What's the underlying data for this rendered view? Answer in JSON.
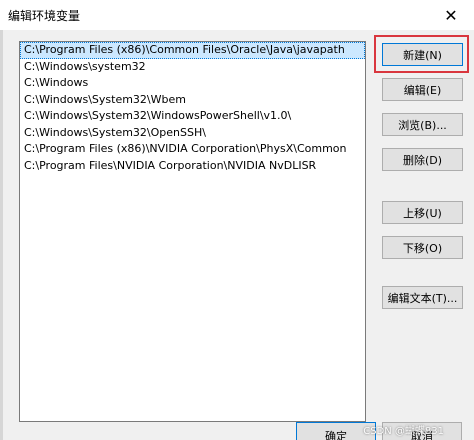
{
  "window": {
    "title": "编辑环境变量",
    "close_glyph": "✕"
  },
  "paths": [
    "C:\\Program Files (x86)\\Common Files\\Oracle\\Java\\javapath",
    "C:\\Windows\\system32",
    "C:\\Windows",
    "C:\\Windows\\System32\\Wbem",
    "C:\\Windows\\System32\\WindowsPowerShell\\v1.0\\",
    "C:\\Windows\\System32\\OpenSSH\\",
    "C:\\Program Files (x86)\\NVIDIA Corporation\\PhysX\\Common",
    "C:\\Program Files\\NVIDIA Corporation\\NVIDIA NvDLISR"
  ],
  "selected_index": 0,
  "buttons": {
    "new": "新建(N)",
    "edit": "编辑(E)",
    "browse": "浏览(B)...",
    "delete": "删除(D)",
    "move_up": "上移(U)",
    "move_down": "下移(O)",
    "edit_text": "编辑文本(T)..."
  },
  "footer": {
    "ok": "确定",
    "cancel": "取消"
  },
  "watermark": "CSDN @蝴蝶831",
  "colors": {
    "selection": "#cce8ff",
    "highlight_box": "#d9363e",
    "default_border": "#0078d7"
  }
}
